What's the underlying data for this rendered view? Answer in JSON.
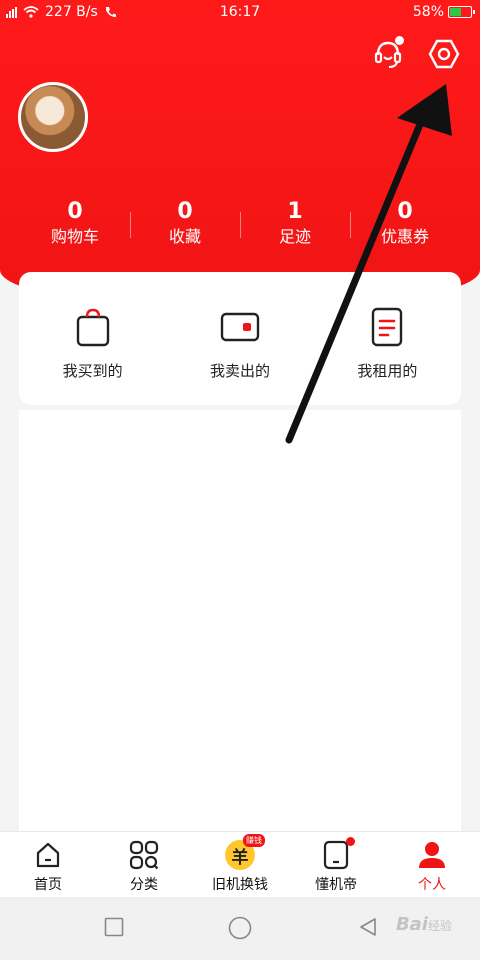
{
  "status_bar": {
    "network_speed": "227 B/s",
    "time": "16:17",
    "battery_percent": "58%",
    "battery_level": 0.58
  },
  "header": {
    "icons": [
      "customer-service-icon",
      "settings-hexagon-icon"
    ]
  },
  "stats": [
    {
      "value": "0",
      "label": "购物车"
    },
    {
      "value": "0",
      "label": "收藏"
    },
    {
      "value": "1",
      "label": "足迹"
    },
    {
      "value": "0",
      "label": "优惠券"
    }
  ],
  "orders": [
    {
      "label": "我买到的",
      "icon": "shopping-bag-icon"
    },
    {
      "label": "我卖出的",
      "icon": "wallet-icon"
    },
    {
      "label": "我租用的",
      "icon": "document-icon"
    }
  ],
  "tabs": [
    {
      "label": "首页",
      "icon": "home-icon",
      "active": false
    },
    {
      "label": "分类",
      "icon": "category-icon",
      "active": false
    },
    {
      "label": "旧机换钱",
      "icon": "coin-icon",
      "badge": "赚钱",
      "coin_glyph": "羊",
      "active": false
    },
    {
      "label": "懂机帝",
      "icon": "phone-icon",
      "active": false
    },
    {
      "label": "个人",
      "icon": "person-icon",
      "active": true
    }
  ],
  "watermark": {
    "text": "Bai",
    "suffix": "经验"
  },
  "colors": {
    "brand_red": "#f01414",
    "coin_yellow": "#ffc62e",
    "battery_green": "#31c845"
  }
}
